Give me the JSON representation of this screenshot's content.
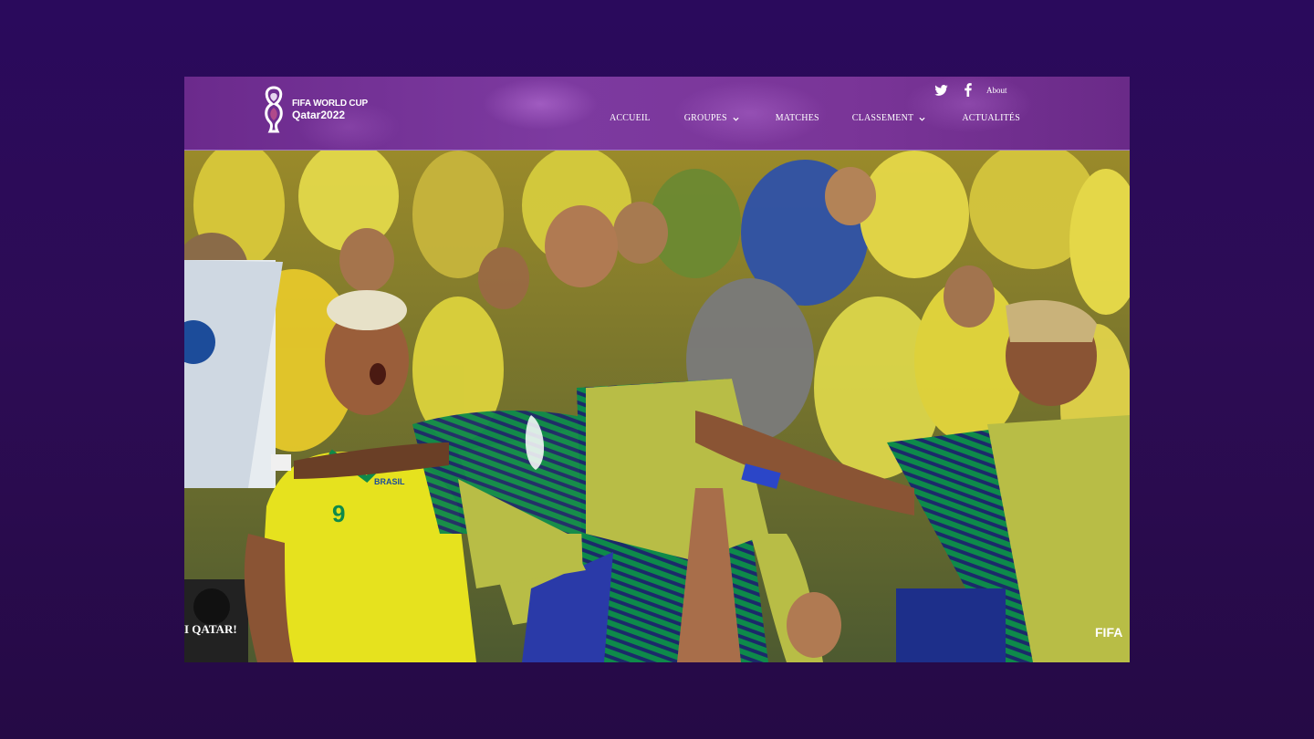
{
  "header": {
    "logo_line1": "FIFA WORLD CUP",
    "logo_line2": "Qatar2022",
    "about_label": "About",
    "social": [
      {
        "icon": "twitter-icon"
      },
      {
        "icon": "facebook-icon"
      }
    ],
    "nav": [
      {
        "label": "ACCUEIL",
        "has_dropdown": false
      },
      {
        "label": "GROUPES",
        "has_dropdown": true
      },
      {
        "label": "MATCHES",
        "has_dropdown": false
      },
      {
        "label": "CLASSEMENT",
        "has_dropdown": true
      },
      {
        "label": "ACTUALITÉS",
        "has_dropdown": false
      }
    ]
  },
  "hero": {
    "jersey_text": "BRASIL",
    "jersey_number": "9",
    "banner_text": "I QATAR!",
    "bib_text": "FIFA"
  },
  "colors": {
    "brand_purple": "#7a3598",
    "jersey_yellow": "#e6e21e",
    "bib_olive": "#b8bd46",
    "stripe_green": "#0e8a4a",
    "stripe_navy": "#1b2a6a"
  }
}
